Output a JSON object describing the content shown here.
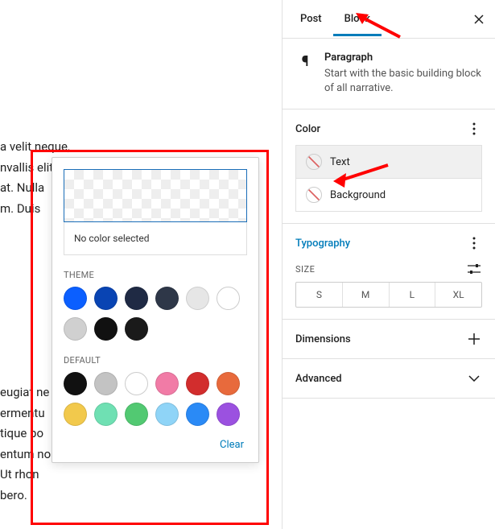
{
  "editor": {
    "para1": "a velit neque,\nnvallis elit viverra\nat. Nulla\nm. Duis",
    "para2": "eugiat ne\nermentu\ntique po\nentum no\n Ut rhon\nbero."
  },
  "tabs": {
    "post": "Post",
    "block": "Block"
  },
  "block": {
    "title": "Paragraph",
    "desc": "Start with the basic building block of all narrative."
  },
  "panel_color": {
    "title": "Color",
    "text": "Text",
    "background": "Background"
  },
  "panel_typo": {
    "title": "Typography",
    "size_label": "SIZE",
    "sizes": [
      "S",
      "M",
      "L",
      "XL"
    ]
  },
  "panel_dim": {
    "title": "Dimensions"
  },
  "panel_adv": {
    "title": "Advanced"
  },
  "popover": {
    "no_color": "No color selected",
    "theme_label": "THEME",
    "default_label": "DEFAULT",
    "clear": "Clear",
    "theme_colors": [
      "#0b5fff",
      "#0944b3",
      "#1f2a44",
      "#2e3748",
      "#e6e6e6",
      "#ffffff",
      "#d0d0d0",
      "#111111",
      "#1a1a1a"
    ],
    "default_colors": [
      "#111111",
      "#c3c3c3",
      "#ffffff",
      "#f17ba6",
      "#d22d2d",
      "#e86a3c",
      "#f2c94c",
      "#6fe0b3",
      "#52c972",
      "#8fd4f7",
      "#2a8af6",
      "#9b51e0"
    ]
  }
}
